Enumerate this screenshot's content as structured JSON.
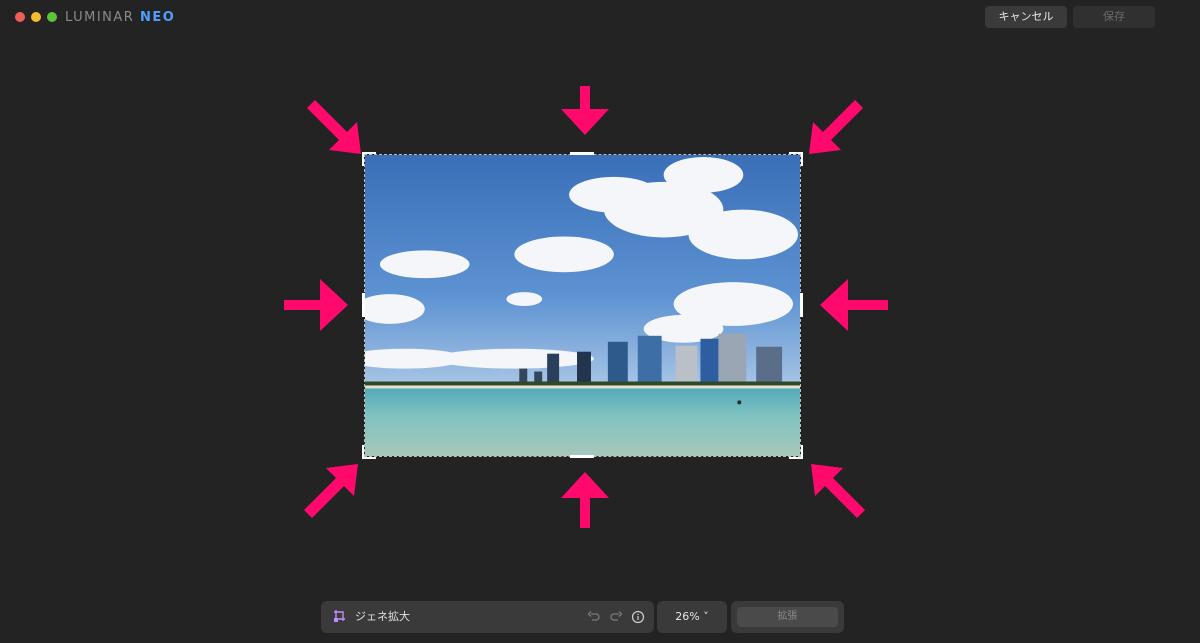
{
  "app": {
    "logo_main": "LUMINAR",
    "logo_accent": "NEO"
  },
  "header": {
    "cancel_label": "キャンセル",
    "save_label": "保存"
  },
  "toolbar": {
    "tool_name": "ジェネ拡大",
    "tool_icon": "crop-expand-icon",
    "zoom_label": "26% ˅",
    "expand_label": "拡張"
  },
  "colors": {
    "background": "#232323",
    "arrow": "#ff0a6c",
    "panel": "#3a3a3a"
  }
}
